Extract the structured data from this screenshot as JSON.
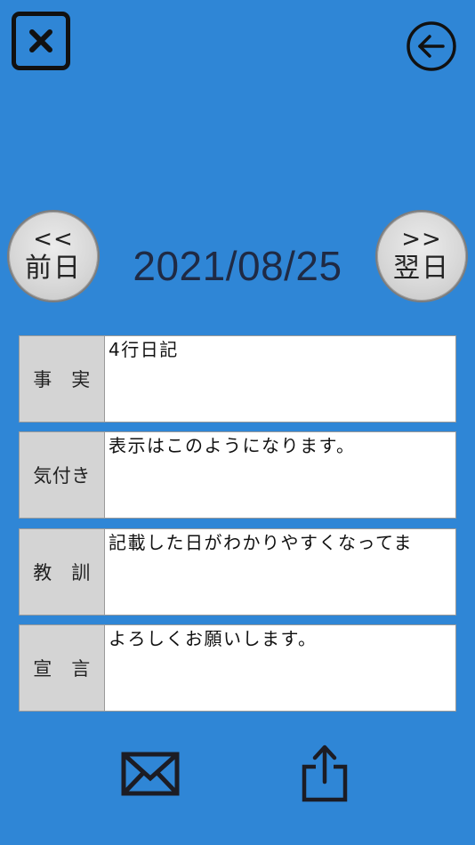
{
  "icons": {
    "close": "close-x-icon",
    "back": "back-arrow-circle-icon",
    "mail": "mail-icon",
    "share": "share-icon"
  },
  "nav": {
    "prev_arrow": "<<",
    "prev_label": "前日",
    "next_arrow": ">>",
    "next_label": "翌日"
  },
  "date": "2021/08/25",
  "entries": [
    {
      "label": "事　実",
      "value": "4行日記"
    },
    {
      "label": "気付き",
      "value": "表示はこのようになります。"
    },
    {
      "label": "教　訓",
      "value": "記載した日がわかりやすくなってま"
    },
    {
      "label": "宣　言",
      "value": "よろしくお願いします。"
    }
  ],
  "colors": {
    "background": "#2f86d6",
    "button_face": "#d8d8d8",
    "label_cell": "#d4d4d4",
    "field": "#ffffff",
    "date_text": "#1f2a44"
  }
}
